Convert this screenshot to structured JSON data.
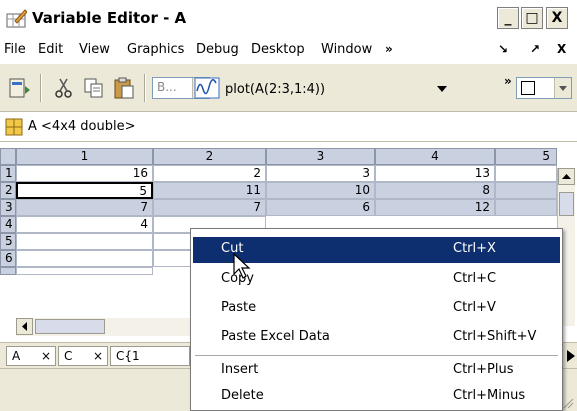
{
  "window": {
    "title": "Variable Editor - A",
    "controls": {
      "minimize": "_",
      "maximize": "□",
      "close": "X"
    }
  },
  "menubar": {
    "items": [
      "File",
      "Edit",
      "View",
      "Graphics",
      "Debug",
      "Desktop",
      "Window"
    ],
    "overflow": "»",
    "dock": "↘",
    "undock": "↗",
    "close": "X"
  },
  "toolbar": {
    "brush_combo": "B...",
    "plot_label": "plot(A(2:3,1:4))",
    "overflow": "»"
  },
  "info": {
    "label": "A <4x4 double>"
  },
  "grid": {
    "column_headers": [
      "1",
      "2",
      "3",
      "4",
      "5"
    ],
    "row_headers": [
      "1",
      "2",
      "3",
      "4",
      "5",
      "6"
    ],
    "rows": [
      [
        "16",
        "2",
        "3",
        "13",
        ""
      ],
      [
        "5",
        "11",
        "10",
        "8",
        ""
      ],
      [
        "7",
        "7",
        "6",
        "12",
        ""
      ],
      [
        "4",
        "",
        "",
        "",
        ""
      ],
      [
        "",
        "",
        "",
        "",
        ""
      ],
      [
        "",
        "",
        "",
        "",
        ""
      ]
    ]
  },
  "tabs": [
    {
      "label": "A",
      "close": "×"
    },
    {
      "label": "C",
      "close": "×"
    },
    {
      "label": "C{1",
      "close": ""
    }
  ],
  "context_menu": {
    "items": [
      {
        "label": "Cut",
        "shortcut": "Ctrl+X"
      },
      {
        "label": "Copy",
        "shortcut": "Ctrl+C"
      },
      {
        "label": "Paste",
        "shortcut": "Ctrl+V"
      },
      {
        "label": "Paste Excel Data",
        "shortcut": "Ctrl+Shift+V"
      },
      {
        "label": "Insert",
        "shortcut": "Ctrl+Plus"
      },
      {
        "label": "Delete",
        "shortcut": "Ctrl+Minus"
      }
    ]
  },
  "colors": {
    "selection": "#c9d1e1",
    "menu_highlight": "#0d2f6f"
  }
}
